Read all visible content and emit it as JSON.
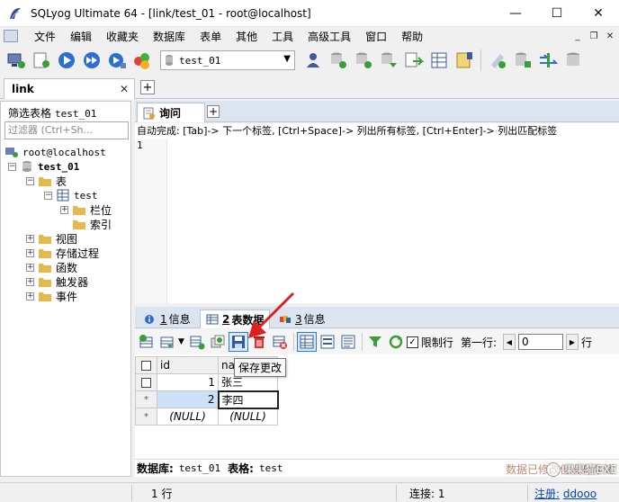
{
  "window": {
    "title": "SQLyog Ultimate 64 - [link/test_01 - root@localhost]",
    "minimize": "—",
    "maximize": "☐",
    "close": "✕"
  },
  "menu": {
    "items": [
      "文件",
      "编辑",
      "收藏夹",
      "数据库",
      "表单",
      "其他",
      "工具",
      "高级工具",
      "窗口",
      "帮助"
    ],
    "mdi_min": "_",
    "mdi_restore": "❐",
    "mdi_close": "✕"
  },
  "toolbar": {
    "database_select": "test_01"
  },
  "connection_tabs": {
    "active": "link",
    "close": "✕",
    "add": "+"
  },
  "left_panel": {
    "filter_label": "筛选表格",
    "filter_table": "test_01",
    "filter_placeholder": "过滤器 (Ctrl+Sh...",
    "tree": {
      "connection": "root@localhost",
      "database": "test_01",
      "tables_folder": "表",
      "table": "test",
      "columns_folder": "栏位",
      "indexes_folder": "索引",
      "views": "视图",
      "procedures": "存储过程",
      "functions": "函数",
      "triggers": "触发器",
      "events": "事件"
    }
  },
  "query_tabs": {
    "active": "询问",
    "add": "+"
  },
  "editor": {
    "autocomplete_hint": "自动完成:  [Tab]-> 下一个标签,  [Ctrl+Space]-> 列出所有标签,  [Ctrl+Enter]-> 列出匹配标签",
    "line_number": "1"
  },
  "result_tabs": [
    {
      "num": "1",
      "label": "信息"
    },
    {
      "num": "2",
      "label": "表数据"
    },
    {
      "num": "3",
      "label": "信息"
    }
  ],
  "result_toolbar": {
    "limit_rows_label": "限制行",
    "first_row_label": "第一行:",
    "first_row_value": "0",
    "rows_label": "行"
  },
  "tooltip": "保存更改",
  "grid": {
    "columns": [
      "id",
      "name"
    ],
    "rows": [
      {
        "marker": "",
        "id": "1",
        "name": "张三"
      },
      {
        "marker": "*",
        "id": "2",
        "name": "李四"
      },
      {
        "marker": "*",
        "id": "(NULL)",
        "name": "(NULL)"
      }
    ]
  },
  "info_strip": {
    "db_label": "数据库:",
    "db_value": "test_01",
    "table_label": "表格:",
    "table_value": "test",
    "overlay_note": "数据已修改但没有存储",
    "watermark_text": "果果猫EXE"
  },
  "statusbar": {
    "rows": "1 行",
    "connection": "连接: 1",
    "register_label": "注册:",
    "register_user": "ddooo"
  },
  "colors": {
    "accent": "#2b7bd6",
    "arrow": "#e02020",
    "selection": "#cce0f7"
  }
}
